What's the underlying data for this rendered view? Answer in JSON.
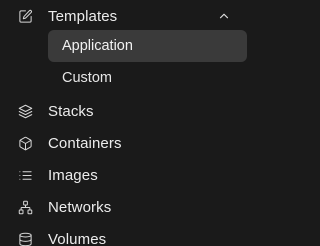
{
  "sidebar": {
    "templates": {
      "label": "Templates",
      "icon": "edit-icon",
      "expanded": true,
      "children": [
        {
          "label": "Application",
          "active": true
        },
        {
          "label": "Custom",
          "active": false
        }
      ]
    },
    "items": [
      {
        "label": "Stacks",
        "icon": "layers-icon"
      },
      {
        "label": "Containers",
        "icon": "box-icon"
      },
      {
        "label": "Images",
        "icon": "list-icon"
      },
      {
        "label": "Networks",
        "icon": "network-icon"
      },
      {
        "label": "Volumes",
        "icon": "database-icon"
      }
    ]
  },
  "colors": {
    "background": "#1a1a1a",
    "active_item": "#3a3a3a",
    "text": "#ececec"
  }
}
